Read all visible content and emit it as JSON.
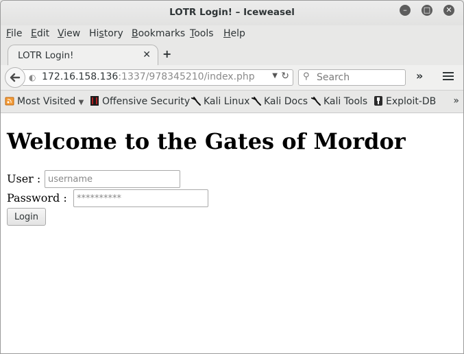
{
  "window": {
    "title": "LOTR Login! – Iceweasel",
    "minimize_glyph": "–",
    "maximize_glyph": "□",
    "close_glyph": "✕"
  },
  "menubar": {
    "items": [
      {
        "label": "File",
        "accel": "F",
        "rest": "ile"
      },
      {
        "label": "Edit",
        "accel": "E",
        "rest": "dit"
      },
      {
        "label": "View",
        "accel": "V",
        "rest": "iew"
      },
      {
        "label": "History",
        "accel": "s",
        "pre": "Hi",
        "rest": "tory"
      },
      {
        "label": "Bookmarks",
        "accel": "B",
        "rest": "ookmarks"
      },
      {
        "label": "Tools",
        "accel": "T",
        "rest": "ools"
      },
      {
        "label": "Help",
        "accel": "H",
        "rest": "elp"
      }
    ]
  },
  "tabs": [
    {
      "label": "LOTR Login!",
      "active": true
    }
  ],
  "newtab_glyph": "+",
  "navbar": {
    "url_host": "172.16.158.136",
    "url_rest": ":1337/978345210/index.php",
    "search_placeholder": "Search",
    "overflow_glyph": "»"
  },
  "bookmarks": [
    {
      "label": "Most Visited",
      "icon": "most-visited-icon",
      "dropdown": "▼"
    },
    {
      "label": "Offensive Security",
      "icon": "offsec-icon"
    },
    {
      "label": "Kali Linux",
      "icon": "kali-dragon-icon"
    },
    {
      "label": "Kali Docs",
      "icon": "kali-dragon-icon"
    },
    {
      "label": "Kali Tools",
      "icon": "kali-dragon-icon"
    },
    {
      "label": "Exploit-DB",
      "icon": "exploitdb-icon"
    }
  ],
  "bookmarks_more_glyph": "»",
  "page": {
    "heading": "Welcome to the Gates of Mordor",
    "user_label": "User :",
    "user_placeholder": "username",
    "password_label": "Password :",
    "password_placeholder": "**********",
    "login_label": "Login"
  },
  "colors": {
    "window_bg": "#e8e8e7",
    "content_bg": "#ffffff",
    "text": "#2e3436"
  }
}
